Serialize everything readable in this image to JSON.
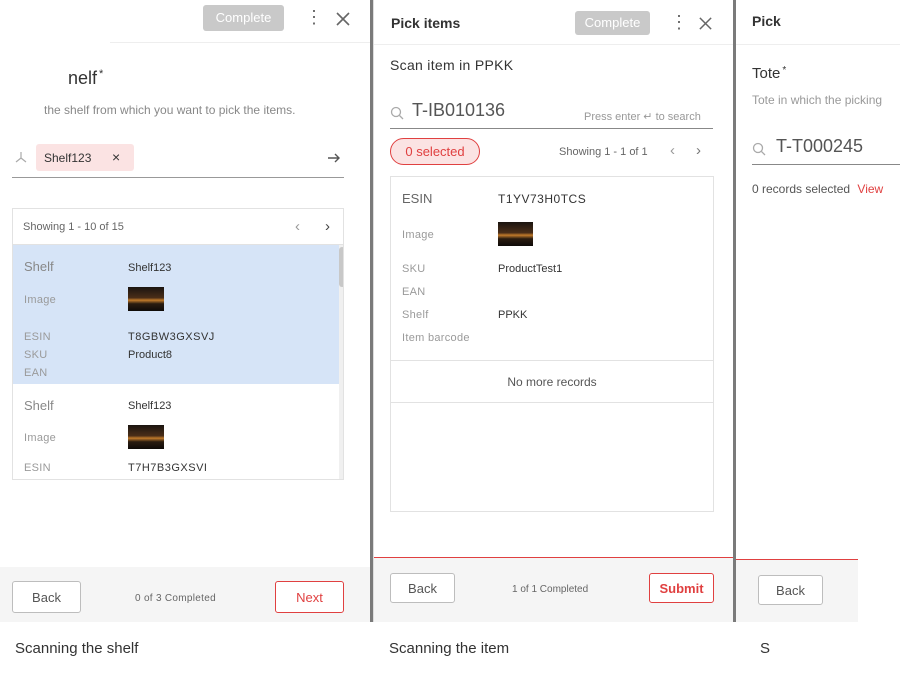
{
  "panel1": {
    "complete_label": "Complete",
    "title": "nelf",
    "subtitle": "the shelf from which you want to pick the items.",
    "chip_label": "Shelf123",
    "chip_remove": "×",
    "showing": "Showing 1 - 10 of 15",
    "cards": [
      {
        "shelf_label": "Shelf",
        "shelf_value": "Shelf123",
        "image_label": "Image",
        "esin_label": "ESIN",
        "esin_value": "T8GBW3GXSVJ",
        "sku_label": "SKU",
        "sku_value": "Product8",
        "ean_label": "EAN"
      },
      {
        "shelf_label": "Shelf",
        "shelf_value": "Shelf123",
        "image_label": "Image",
        "esin_label": "ESIN",
        "esin_value": "T7H7B3GXSVI"
      }
    ],
    "back_label": "Back",
    "progress": "0 of 3 Completed",
    "next_label": "Next",
    "caption": "Scanning the shelf"
  },
  "panel2": {
    "title": "Pick items",
    "complete_label": "Complete",
    "scan_title": "Scan item in PPKK",
    "search_value": "T-IB010136",
    "search_hint": "Press enter ↵ to search",
    "selected_badge": "0 selected",
    "showing": "Showing 1 - 1 of 1",
    "card": {
      "esin_label": "ESIN",
      "esin_value": "T1YV73H0TCS",
      "image_label": "Image",
      "sku_label": "SKU",
      "sku_value": "ProductTest1",
      "ean_label": "EAN",
      "shelf_label": "Shelf",
      "shelf_value": "PPKK",
      "barcode_label": "Item barcode"
    },
    "no_more": "No more records",
    "back_label": "Back",
    "progress": "1 of 1 Completed",
    "submit_label": "Submit",
    "caption": "Scanning the item"
  },
  "panel3": {
    "title": "Pick",
    "tote_label": "Tote",
    "tote_desc": "Tote in which the picking",
    "search_value": "T-T000245",
    "records_selected": "0 records selected",
    "view_link": "View",
    "back_label": "Back",
    "caption": "S"
  },
  "colors": {
    "accent_red": "#e04040",
    "selected_blue": "#d6e4f7",
    "chip_pink": "#fbe3e3",
    "disabled_gray": "#c9c9c9"
  }
}
